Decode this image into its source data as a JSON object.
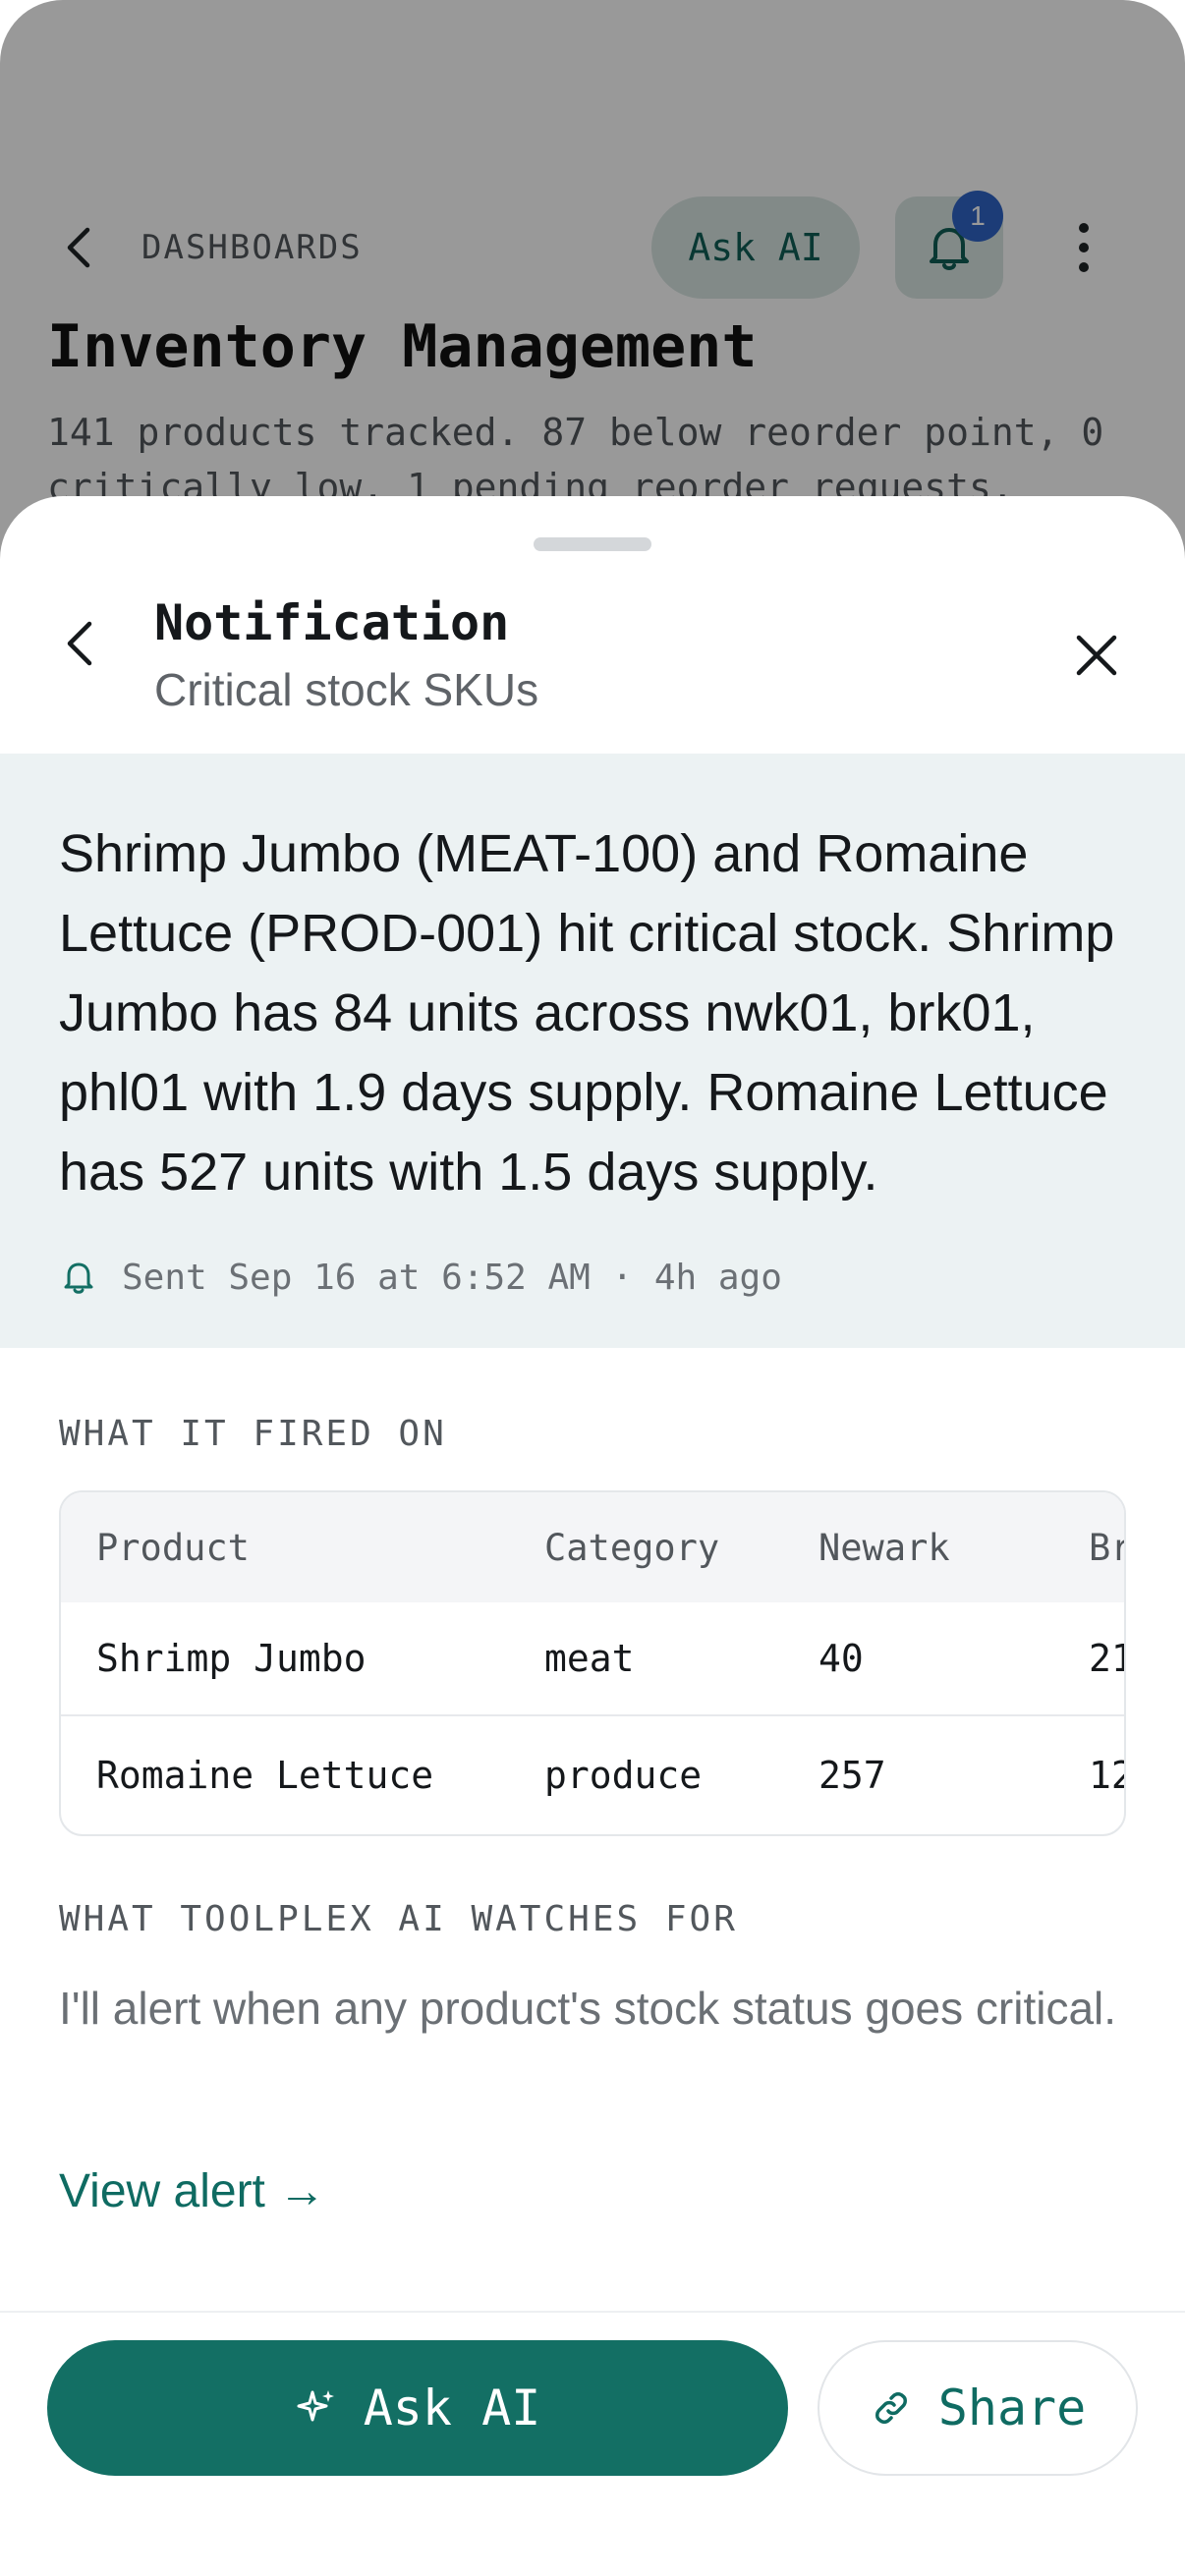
{
  "background": {
    "breadcrumb": "DASHBOARDS",
    "ask_ai_label": "Ask AI",
    "notification_count": "1",
    "title": "Inventory Management",
    "description": "141 products tracked. 87 below reorder point, 0 critically low. 1 pending reorder requests."
  },
  "sheet": {
    "title": "Notification",
    "subtitle": "Critical stock SKUs",
    "message": "Shrimp Jumbo (MEAT-100) and Romaine Lettuce (PROD-001) hit critical stock. Shrimp Jumbo has 84 units across nwk01, brk01, phl01 with 1.9 days supply. Romaine Lettuce has 527 units with 1.5 days supply.",
    "sent": "Sent Sep 16 at 6:52 AM · 4h ago",
    "fired_label": "WHAT IT FIRED ON",
    "table": {
      "columns": [
        "Product",
        "Category",
        "Newark",
        "Br"
      ],
      "rows": [
        [
          "Shrimp Jumbo",
          "meat",
          "40",
          "21"
        ],
        [
          "Romaine Lettuce",
          "produce",
          "257",
          "12"
        ]
      ]
    },
    "watches_label": "WHAT TOOLPLEX AI WATCHES FOR",
    "watches_text": "I'll alert when any product's stock status goes critical.",
    "view_alert": "View alert →",
    "ask_ai_button": "Ask AI",
    "share_button": "Share"
  },
  "colors": {
    "accent": "#136f64",
    "badge": "#2f65c6",
    "message_bg": "#ecf2f3"
  },
  "icons": [
    "back-arrow-icon",
    "bell-icon",
    "more-vertical-icon",
    "close-icon",
    "sparkle-icon",
    "link-icon"
  ]
}
